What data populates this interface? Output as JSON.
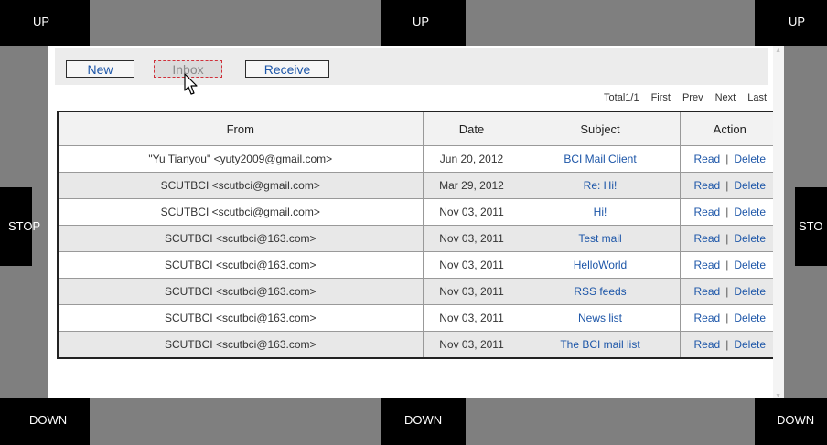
{
  "controls": {
    "up": "UP",
    "down": "DOWN",
    "stop_left": "STOP",
    "stop_right": "STO"
  },
  "toolbar": {
    "new_label": "New",
    "inbox_label": "Inbox",
    "receive_label": "Receive"
  },
  "pager": {
    "total": "Total1/1",
    "first": "First",
    "prev": "Prev",
    "next": "Next",
    "last": "Last"
  },
  "table": {
    "headers": {
      "from": "From",
      "date": "Date",
      "subject": "Subject",
      "action": "Action"
    },
    "read_label": "Read",
    "separator": "|",
    "delete_label": "Delete",
    "rows": [
      {
        "from": "\"Yu Tianyou\" <yuty2009@gmail.com>",
        "date": "Jun 20, 2012",
        "subject": "BCI Mail Client"
      },
      {
        "from": "SCUTBCI <scutbci@gmail.com>",
        "date": "Mar 29, 2012",
        "subject": "Re: Hi!"
      },
      {
        "from": "SCUTBCI <scutbci@gmail.com>",
        "date": "Nov 03, 2011",
        "subject": "Hi!"
      },
      {
        "from": "SCUTBCI <scutbci@163.com>",
        "date": "Nov 03, 2011",
        "subject": "Test mail"
      },
      {
        "from": "SCUTBCI <scutbci@163.com>",
        "date": "Nov 03, 2011",
        "subject": "HelloWorld"
      },
      {
        "from": "SCUTBCI <scutbci@163.com>",
        "date": "Nov 03, 2011",
        "subject": "RSS feeds"
      },
      {
        "from": "SCUTBCI <scutbci@163.com>",
        "date": "Nov 03, 2011",
        "subject": "News list"
      },
      {
        "from": "SCUTBCI <scutbci@163.com>",
        "date": "Nov 03, 2011",
        "subject": "The BCI mail list"
      }
    ]
  }
}
